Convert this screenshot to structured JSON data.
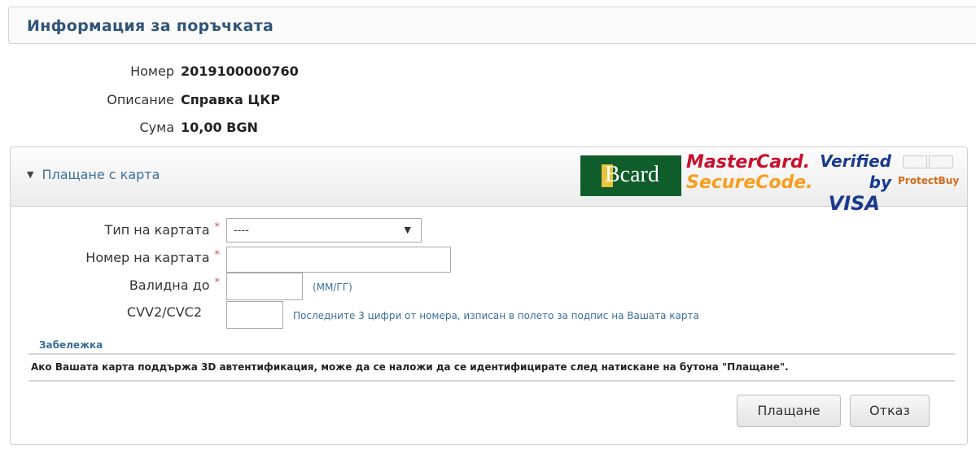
{
  "header": {
    "title": "Информация за поръчката"
  },
  "order": [
    {
      "label": "Номер",
      "value": "2019100000760"
    },
    {
      "label": "Описание",
      "value": "Справка ЦКР"
    },
    {
      "label": "Сума",
      "value": "10,00 BGN"
    }
  ],
  "payment_panel": {
    "title": "Плащане с карта",
    "logos": {
      "bcard": "Bcard",
      "mastercard_line1": "MasterCard.",
      "mastercard_line2": "SecureCode.",
      "visa_line1": "Verified by",
      "visa_line2": "VISA",
      "protectbuy": "ProtectBuy"
    }
  },
  "form": {
    "card_type": {
      "label": "Тип на картата",
      "required_mark": "*",
      "value": "----"
    },
    "card_number": {
      "label": "Номер на картата",
      "required_mark": "*",
      "value": ""
    },
    "valid_until": {
      "label": "Валидна до",
      "required_mark": "*",
      "value": "",
      "hint": "(ММ/ГГ)"
    },
    "cvv": {
      "label": "CVV2/CVC2",
      "value": "",
      "hint": "Последните 3 цифри от номера, изписан в полето за подпис на Вашата карта"
    }
  },
  "note": {
    "title": "Забележка",
    "text": "Ако Вашата карта поддържа 3D автентификация, може да се наложи да се идентифицирате след натискане на бутона \"Плащане\"."
  },
  "buttons": {
    "pay": "Плащане",
    "cancel": "Отказ"
  },
  "colors": {
    "title_blue": "#315577",
    "link_blue": "#3b6f9a",
    "required_red": "#d9534f"
  }
}
